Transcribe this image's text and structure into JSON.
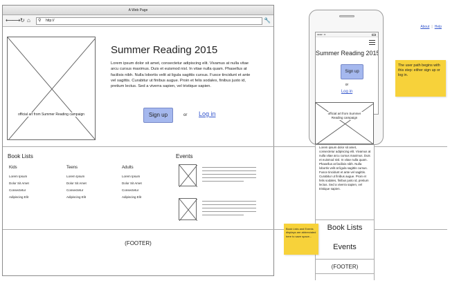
{
  "desktop": {
    "window_title": "A Web Page",
    "nav": {
      "back": "⟵",
      "forward": "⟶",
      "refresh": "↻",
      "home": "⌂"
    },
    "address": "http://",
    "links": {
      "about": "About",
      "help": "Help"
    },
    "hero": {
      "image_caption": "official art from Summer Reading campaign",
      "title": "Summer Reading 2015",
      "body": "Lorem ipsum dolor sit amet, consectetur adipiscing elit. Vivamus at nulla vitae arcu cursus maximus. Duis et euismod nisl. In vitae nulla quam. Phasellus at facilisis nibh. Nulla lobortis velit at ligula sagittis cursus. Fusce tincidunt et ante vel sagittis. Curabitur ut finibus augue. Proin et felis sodales, finibus justo id, pretium lectus. Sed a viverra sapien, vel tristique sapien.",
      "signup_label": "Sign up",
      "or_label": "or",
      "login_label": "Log in"
    },
    "book_lists": {
      "title": "Book Lists",
      "columns": [
        {
          "heading": "Kids",
          "items": [
            "Lorem Ipsum",
            "Dolor Sit Amet",
            "Consectetur",
            "Adipiscing Elit"
          ]
        },
        {
          "heading": "Teens",
          "items": [
            "Lorem Ipsum",
            "Dolor Sit Amet",
            "Consectetur",
            "Adipiscing Elit"
          ]
        },
        {
          "heading": "Adults",
          "items": [
            "Lorem Ipsum",
            "Dolor Sit Amet",
            "Consectetur",
            "Adipiscing Elit"
          ]
        }
      ]
    },
    "events": {
      "title": "Events"
    },
    "footer": "(FOOTER)"
  },
  "mobile": {
    "status": "●●●●○ ≋",
    "title": "Summer Reading 2015",
    "signup_label": "Sign up",
    "or_label": "or",
    "login_label": "Log in",
    "image_caption": "official art from Summer Reading campaign",
    "body": "Lorem ipsum dolor sit amet, consectetur adipiscing elit. Vivamus at nulla vitae arcu cursus maximus. Duis et euismod nisl. In vitae nulla quam. Phasellus at facilisis nibh. Nulla lobortis velit at ligula sagittis cursus. Fusce tincidunt et ante vel sagittis. Curabitur ut finibus augue. Proin et felis sodales, finibus justo id, pretium lectus. Sed a viverra sapien, vel tristique sapien.",
    "book_lists": "Book Lists",
    "events": "Events",
    "footer": "(FOOTER)"
  },
  "notes": {
    "user_path": "The user path begins with this step: either sign up or log in.",
    "abbreviated": "Book Lists and Events displays are abbreviated here to save space..."
  },
  "colors": {
    "button": "#a5b8ee",
    "link": "#3355cc",
    "sticky_note": "#f7d23a"
  }
}
